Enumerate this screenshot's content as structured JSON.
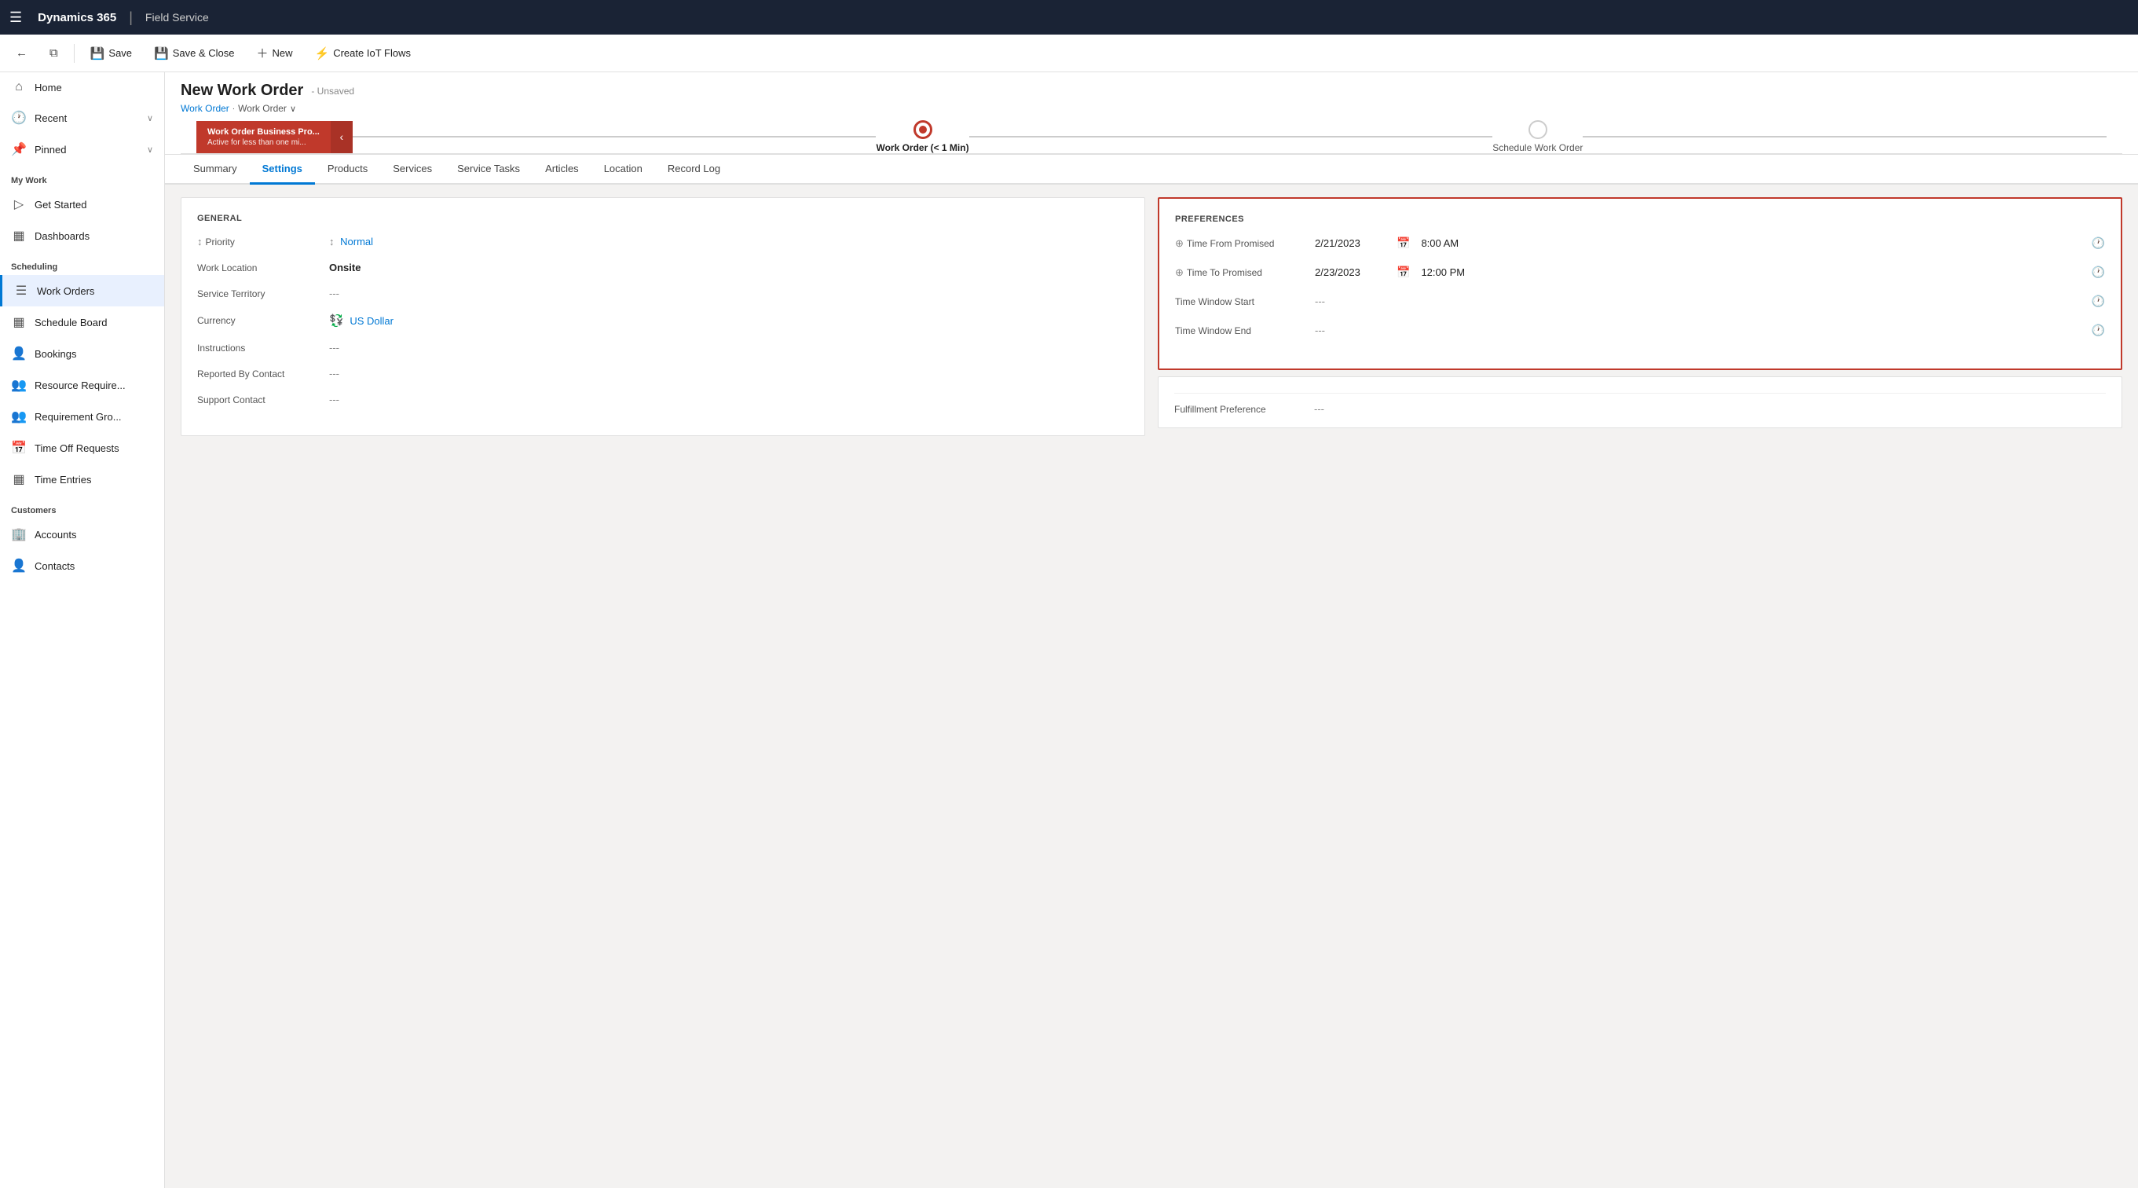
{
  "topNav": {
    "hamburger": "☰",
    "brand": "Dynamics 365",
    "divider": "|",
    "module": "Field Service"
  },
  "commandBar": {
    "back_icon": "←",
    "popout_icon": "⧉",
    "save_label": "Save",
    "save_close_label": "Save & Close",
    "new_label": "New",
    "iot_label": "Create IoT Flows"
  },
  "sidebar": {
    "items": [
      {
        "id": "home",
        "label": "Home",
        "icon": "⌂"
      },
      {
        "id": "recent",
        "label": "Recent",
        "icon": "🕐",
        "chevron": "∨"
      },
      {
        "id": "pinned",
        "label": "Pinned",
        "icon": "📌",
        "chevron": "∨"
      }
    ],
    "sections": [
      {
        "label": "My Work",
        "items": [
          {
            "id": "get-started",
            "label": "Get Started",
            "icon": "▷"
          },
          {
            "id": "dashboards",
            "label": "Dashboards",
            "icon": "▦"
          }
        ]
      },
      {
        "label": "Scheduling",
        "items": [
          {
            "id": "work-orders",
            "label": "Work Orders",
            "icon": "☰",
            "active": true
          },
          {
            "id": "schedule-board",
            "label": "Schedule Board",
            "icon": "▦"
          },
          {
            "id": "bookings",
            "label": "Bookings",
            "icon": "👤"
          },
          {
            "id": "resource-req",
            "label": "Resource Require...",
            "icon": "👥"
          },
          {
            "id": "requirement-gro",
            "label": "Requirement Gro...",
            "icon": "👥"
          },
          {
            "id": "time-off-requests",
            "label": "Time Off Requests",
            "icon": "📅"
          },
          {
            "id": "time-entries",
            "label": "Time Entries",
            "icon": "▦"
          }
        ]
      },
      {
        "label": "Customers",
        "items": [
          {
            "id": "accounts",
            "label": "Accounts",
            "icon": "🏢"
          },
          {
            "id": "contacts",
            "label": "Contacts",
            "icon": "👤"
          }
        ]
      }
    ]
  },
  "pageHeader": {
    "title": "New Work Order",
    "status": "- Unsaved",
    "breadcrumb1": "Work Order",
    "breadcrumb2": "Work Order"
  },
  "progressSteps": {
    "pill_title": "Work Order Business Pro...",
    "pill_sub": "Active for less than one mi...",
    "step1_label": "Work Order (< 1 Min)",
    "step2_label": "Schedule Work Order"
  },
  "tabs": [
    {
      "id": "summary",
      "label": "Summary",
      "active": false
    },
    {
      "id": "settings",
      "label": "Settings",
      "active": true
    },
    {
      "id": "products",
      "label": "Products",
      "active": false
    },
    {
      "id": "services",
      "label": "Services",
      "active": false
    },
    {
      "id": "service-tasks",
      "label": "Service Tasks",
      "active": false
    },
    {
      "id": "articles",
      "label": "Articles",
      "active": false
    },
    {
      "id": "location",
      "label": "Location",
      "active": false
    },
    {
      "id": "record-log",
      "label": "Record Log",
      "active": false
    }
  ],
  "general": {
    "section_title": "GENERAL",
    "fields": [
      {
        "id": "priority",
        "label": "Priority",
        "value": "Normal",
        "type": "link",
        "has_icon": true
      },
      {
        "id": "work-location",
        "label": "Work Location",
        "value": "Onsite",
        "type": "text"
      },
      {
        "id": "service-territory",
        "label": "Service Territory",
        "value": "---",
        "type": "empty"
      },
      {
        "id": "currency",
        "label": "Currency",
        "value": "US Dollar",
        "type": "link",
        "has_currency_icon": true
      },
      {
        "id": "instructions",
        "label": "Instructions",
        "value": "---",
        "type": "empty"
      },
      {
        "id": "reported-by",
        "label": "Reported By Contact",
        "value": "---",
        "type": "empty"
      },
      {
        "id": "support-contact",
        "label": "Support Contact",
        "value": "---",
        "type": "empty"
      }
    ]
  },
  "preferences": {
    "section_title": "PREFERENCES",
    "time_from_promised_label": "Time From Promised",
    "time_from_promised_date": "2/21/2023",
    "time_from_promised_time": "8:00 AM",
    "time_to_promised_label": "Time To Promised",
    "time_to_promised_date": "2/23/2023",
    "time_to_promised_time": "12:00 PM",
    "time_window_start_label": "Time Window Start",
    "time_window_start_value": "---",
    "time_window_end_label": "Time Window End",
    "time_window_end_value": "---",
    "fulfillment_label": "Fulfillment Preference",
    "fulfillment_value": "---"
  },
  "icons": {
    "sort_icon": "↕",
    "search_icon": "⊕",
    "calendar_icon": "📅",
    "clock_icon": "🕐",
    "currency_icon": "💱"
  }
}
